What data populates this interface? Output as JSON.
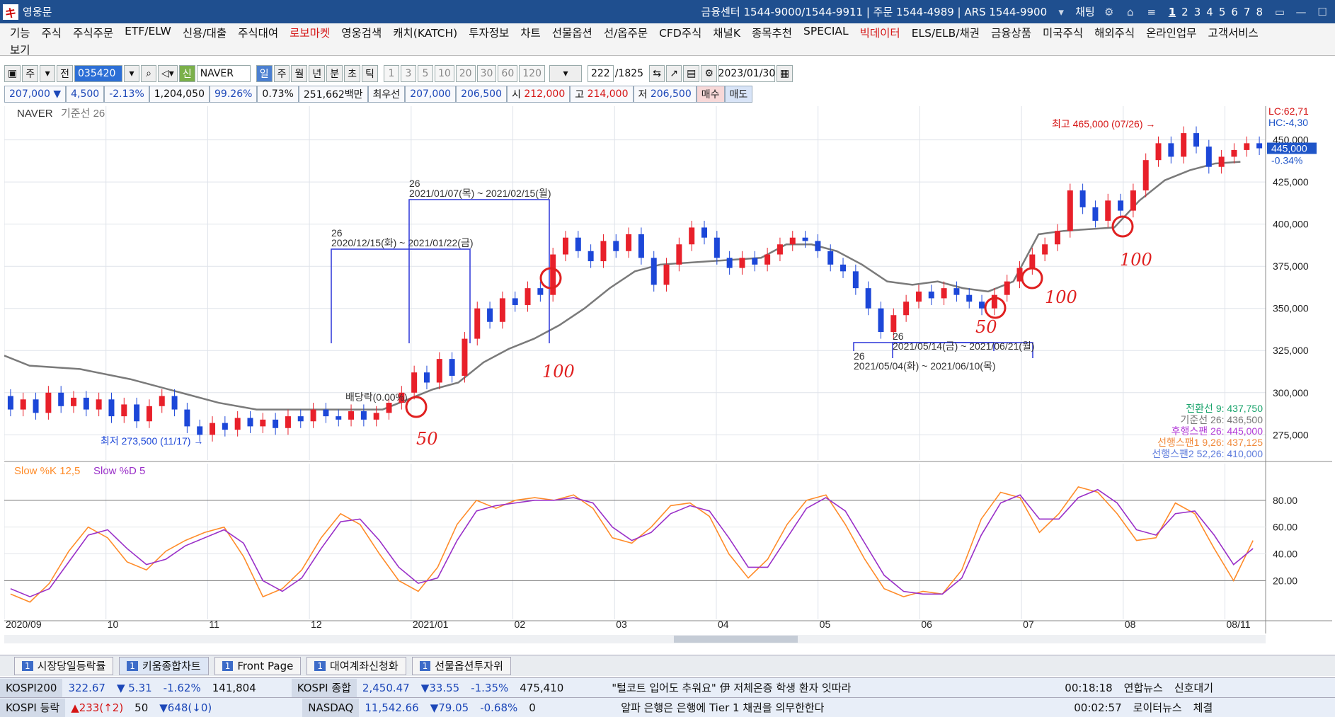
{
  "titlebar": {
    "app_title": "영웅문",
    "info": "금융센터 1544-9000/1544-9911 | 주문 1544-4989 | ARS 1544-9900",
    "chat": "채팅",
    "pages": [
      "1",
      "2",
      "3",
      "4",
      "5",
      "6",
      "7",
      "8"
    ]
  },
  "menu": {
    "items": [
      {
        "label": "기능"
      },
      {
        "label": "주식"
      },
      {
        "label": "주식주문"
      },
      {
        "label": "ETF/ELW"
      },
      {
        "label": "신용/대출"
      },
      {
        "label": "주식대여"
      },
      {
        "label": "로보마켓",
        "color": "red"
      },
      {
        "label": "영웅검색"
      },
      {
        "label": "캐치(KATCH)"
      },
      {
        "label": "투자정보"
      },
      {
        "label": "차트"
      },
      {
        "label": "선물옵션"
      },
      {
        "label": "선/옵주문"
      },
      {
        "label": "CFD주식"
      },
      {
        "label": "채널K"
      },
      {
        "label": "종목추천"
      },
      {
        "label": "SPECIAL"
      },
      {
        "label": "빅데이터",
        "color": "red"
      },
      {
        "label": "ELS/ELB/채권"
      },
      {
        "label": "금융상품"
      },
      {
        "label": "미국주식"
      },
      {
        "label": "해외주식"
      },
      {
        "label": "온라인업무"
      },
      {
        "label": "고객서비스"
      }
    ],
    "row2": "보기"
  },
  "toolbar": {
    "market": "주",
    "prev": "전",
    "code": "035420",
    "new_label": "신",
    "stock_name": "NAVER",
    "periods": [
      "일",
      "주",
      "월",
      "년",
      "분",
      "초",
      "틱"
    ],
    "selected_period": "일",
    "counts": [
      "1",
      "3",
      "5",
      "10",
      "20",
      "30",
      "60",
      "120"
    ],
    "record_count": "222",
    "record_total": "/1825",
    "date": "2023/01/30"
  },
  "quote": {
    "price": "207,000",
    "change": "4,500",
    "change_pct": "-2.13%",
    "volume": "1,204,050",
    "vol_ratio": "99.26%",
    "turnover_pct": "0.73%",
    "amount": "251,662백만",
    "best_label": "최우선",
    "bid1": "207,000",
    "ask1": "206,500",
    "open_label": "시",
    "open": "212,000",
    "high_label": "고",
    "high": "214,000",
    "low_label": "저",
    "low": "206,500",
    "buy_label": "매수",
    "sell_label": "매도"
  },
  "colors": {
    "up": "#e8202a",
    "down": "#1c47d8",
    "kijun": "#7a7a7a",
    "slowk": "#ff8c2a",
    "slowd": "#9a30c8",
    "annotation": "#e02020",
    "boxes": "#2b35d8"
  },
  "chart_data": [
    {
      "type": "line",
      "title": "NAVER",
      "subtitle": "기준선 26",
      "ylim": [
        260000,
        470000
      ],
      "yticks": [
        "275,000",
        "300,000",
        "325,000",
        "350,000",
        "375,000",
        "400,000",
        "425,000",
        "450,000"
      ],
      "xticks": [
        "2020/09",
        "10",
        "11",
        "12",
        "2021/01",
        "02",
        "03",
        "04",
        "05",
        "06",
        "07",
        "08",
        "08/11"
      ],
      "current_price_label": "445,000",
      "current_change_label": "-0.34%",
      "lc_label": "LC:62,71",
      "hc_label": "HC:-4,30",
      "high_label": "최고 465,000 (07/26)",
      "low_label": "최저 273,500 (11/17)",
      "dividend_label": "배당락(0.00%)",
      "kijun_series": [
        {
          "x": 0.0,
          "y": 322000
        },
        {
          "x": 0.02,
          "y": 316000
        },
        {
          "x": 0.06,
          "y": 314000
        },
        {
          "x": 0.1,
          "y": 308000
        },
        {
          "x": 0.14,
          "y": 300000
        },
        {
          "x": 0.17,
          "y": 294000
        },
        {
          "x": 0.2,
          "y": 290000
        },
        {
          "x": 0.26,
          "y": 290000
        },
        {
          "x": 0.3,
          "y": 290000
        },
        {
          "x": 0.32,
          "y": 296000
        },
        {
          "x": 0.34,
          "y": 302000
        },
        {
          "x": 0.36,
          "y": 306000
        },
        {
          "x": 0.38,
          "y": 318000
        },
        {
          "x": 0.4,
          "y": 326000
        },
        {
          "x": 0.42,
          "y": 332000
        },
        {
          "x": 0.44,
          "y": 340000
        },
        {
          "x": 0.46,
          "y": 350000
        },
        {
          "x": 0.48,
          "y": 362000
        },
        {
          "x": 0.5,
          "y": 372000
        },
        {
          "x": 0.52,
          "y": 376000
        },
        {
          "x": 0.56,
          "y": 378000
        },
        {
          "x": 0.6,
          "y": 380000
        },
        {
          "x": 0.62,
          "y": 388000
        },
        {
          "x": 0.64,
          "y": 388000
        },
        {
          "x": 0.66,
          "y": 384000
        },
        {
          "x": 0.68,
          "y": 376000
        },
        {
          "x": 0.7,
          "y": 366000
        },
        {
          "x": 0.72,
          "y": 364000
        },
        {
          "x": 0.74,
          "y": 366000
        },
        {
          "x": 0.76,
          "y": 362000
        },
        {
          "x": 0.78,
          "y": 360000
        },
        {
          "x": 0.8,
          "y": 366000
        },
        {
          "x": 0.82,
          "y": 394000
        },
        {
          "x": 0.84,
          "y": 396000
        },
        {
          "x": 0.88,
          "y": 398000
        },
        {
          "x": 0.9,
          "y": 414000
        },
        {
          "x": 0.92,
          "y": 426000
        },
        {
          "x": 0.94,
          "y": 432000
        },
        {
          "x": 0.96,
          "y": 436000
        },
        {
          "x": 0.98,
          "y": 437000
        }
      ],
      "candles": [
        {
          "x": 0.005,
          "o": 298,
          "c": 290
        },
        {
          "x": 0.015,
          "o": 290,
          "c": 296
        },
        {
          "x": 0.025,
          "o": 296,
          "c": 288
        },
        {
          "x": 0.035,
          "o": 288,
          "c": 300
        },
        {
          "x": 0.045,
          "o": 300,
          "c": 292
        },
        {
          "x": 0.055,
          "o": 292,
          "c": 297
        },
        {
          "x": 0.065,
          "o": 297,
          "c": 290
        },
        {
          "x": 0.075,
          "o": 290,
          "c": 296
        },
        {
          "x": 0.085,
          "o": 296,
          "c": 286
        },
        {
          "x": 0.095,
          "o": 286,
          "c": 293
        },
        {
          "x": 0.105,
          "o": 293,
          "c": 283
        },
        {
          "x": 0.115,
          "o": 283,
          "c": 292
        },
        {
          "x": 0.125,
          "o": 292,
          "c": 298
        },
        {
          "x": 0.135,
          "o": 298,
          "c": 290
        },
        {
          "x": 0.145,
          "o": 290,
          "c": 280
        },
        {
          "x": 0.155,
          "o": 280,
          "c": 275
        },
        {
          "x": 0.165,
          "o": 275,
          "c": 282
        },
        {
          "x": 0.175,
          "o": 282,
          "c": 278
        },
        {
          "x": 0.185,
          "o": 278,
          "c": 285
        },
        {
          "x": 0.195,
          "o": 285,
          "c": 280
        },
        {
          "x": 0.205,
          "o": 280,
          "c": 284
        },
        {
          "x": 0.215,
          "o": 284,
          "c": 279
        },
        {
          "x": 0.225,
          "o": 279,
          "c": 286
        },
        {
          "x": 0.235,
          "o": 286,
          "c": 283
        },
        {
          "x": 0.245,
          "o": 283,
          "c": 290
        },
        {
          "x": 0.255,
          "o": 290,
          "c": 286
        },
        {
          "x": 0.265,
          "o": 286,
          "c": 284
        },
        {
          "x": 0.275,
          "o": 284,
          "c": 289
        },
        {
          "x": 0.285,
          "o": 289,
          "c": 284
        },
        {
          "x": 0.295,
          "o": 284,
          "c": 288
        },
        {
          "x": 0.305,
          "o": 288,
          "c": 294
        },
        {
          "x": 0.315,
          "o": 294,
          "c": 300
        },
        {
          "x": 0.325,
          "o": 300,
          "c": 312
        },
        {
          "x": 0.335,
          "o": 312,
          "c": 306
        },
        {
          "x": 0.345,
          "o": 306,
          "c": 320
        },
        {
          "x": 0.355,
          "o": 320,
          "c": 310
        },
        {
          "x": 0.365,
          "o": 310,
          "c": 332
        },
        {
          "x": 0.375,
          "o": 332,
          "c": 350
        },
        {
          "x": 0.385,
          "o": 350,
          "c": 342
        },
        {
          "x": 0.395,
          "o": 342,
          "c": 356
        },
        {
          "x": 0.405,
          "o": 356,
          "c": 352
        },
        {
          "x": 0.415,
          "o": 352,
          "c": 362
        },
        {
          "x": 0.425,
          "o": 362,
          "c": 358
        },
        {
          "x": 0.435,
          "o": 358,
          "c": 382
        },
        {
          "x": 0.445,
          "o": 382,
          "c": 392
        },
        {
          "x": 0.455,
          "o": 392,
          "c": 384
        },
        {
          "x": 0.465,
          "o": 384,
          "c": 378
        },
        {
          "x": 0.475,
          "o": 378,
          "c": 390
        },
        {
          "x": 0.485,
          "o": 390,
          "c": 384
        },
        {
          "x": 0.495,
          "o": 384,
          "c": 394
        },
        {
          "x": 0.505,
          "o": 394,
          "c": 380
        },
        {
          "x": 0.515,
          "o": 380,
          "c": 364
        },
        {
          "x": 0.525,
          "o": 364,
          "c": 376
        },
        {
          "x": 0.535,
          "o": 376,
          "c": 388
        },
        {
          "x": 0.545,
          "o": 388,
          "c": 398
        },
        {
          "x": 0.555,
          "o": 398,
          "c": 392
        },
        {
          "x": 0.565,
          "o": 392,
          "c": 380
        },
        {
          "x": 0.575,
          "o": 380,
          "c": 374
        },
        {
          "x": 0.585,
          "o": 374,
          "c": 380
        },
        {
          "x": 0.595,
          "o": 380,
          "c": 376
        },
        {
          "x": 0.605,
          "o": 376,
          "c": 382
        },
        {
          "x": 0.615,
          "o": 382,
          "c": 388
        },
        {
          "x": 0.625,
          "o": 388,
          "c": 392
        },
        {
          "x": 0.635,
          "o": 392,
          "c": 390
        },
        {
          "x": 0.645,
          "o": 390,
          "c": 384
        },
        {
          "x": 0.655,
          "o": 384,
          "c": 376
        },
        {
          "x": 0.665,
          "o": 376,
          "c": 372
        },
        {
          "x": 0.675,
          "o": 372,
          "c": 362
        },
        {
          "x": 0.685,
          "o": 362,
          "c": 350
        },
        {
          "x": 0.695,
          "o": 350,
          "c": 336
        },
        {
          "x": 0.705,
          "o": 336,
          "c": 346
        },
        {
          "x": 0.715,
          "o": 346,
          "c": 354
        },
        {
          "x": 0.725,
          "o": 354,
          "c": 360
        },
        {
          "x": 0.735,
          "o": 360,
          "c": 356
        },
        {
          "x": 0.745,
          "o": 356,
          "c": 362
        },
        {
          "x": 0.755,
          "o": 362,
          "c": 358
        },
        {
          "x": 0.765,
          "o": 358,
          "c": 354
        },
        {
          "x": 0.775,
          "o": 354,
          "c": 350
        },
        {
          "x": 0.785,
          "o": 350,
          "c": 358
        },
        {
          "x": 0.795,
          "o": 358,
          "c": 366
        },
        {
          "x": 0.805,
          "o": 366,
          "c": 374
        },
        {
          "x": 0.815,
          "o": 374,
          "c": 382
        },
        {
          "x": 0.825,
          "o": 382,
          "c": 388
        },
        {
          "x": 0.835,
          "o": 388,
          "c": 396
        },
        {
          "x": 0.845,
          "o": 396,
          "c": 420
        },
        {
          "x": 0.855,
          "o": 420,
          "c": 410
        },
        {
          "x": 0.865,
          "o": 410,
          "c": 402
        },
        {
          "x": 0.875,
          "o": 402,
          "c": 414
        },
        {
          "x": 0.885,
          "o": 414,
          "c": 408
        },
        {
          "x": 0.895,
          "o": 408,
          "c": 420
        },
        {
          "x": 0.905,
          "o": 420,
          "c": 438
        },
        {
          "x": 0.915,
          "o": 438,
          "c": 448
        },
        {
          "x": 0.925,
          "o": 448,
          "c": 440
        },
        {
          "x": 0.935,
          "o": 440,
          "c": 454
        },
        {
          "x": 0.945,
          "o": 454,
          "c": 446
        },
        {
          "x": 0.955,
          "o": 446,
          "c": 434
        },
        {
          "x": 0.965,
          "o": 434,
          "c": 440
        },
        {
          "x": 0.975,
          "o": 440,
          "c": 444
        },
        {
          "x": 0.985,
          "o": 444,
          "c": 448
        },
        {
          "x": 0.995,
          "o": 448,
          "c": 445
        }
      ],
      "legend": [
        {
          "label": "전환선 9: 437,750",
          "color": "#18a36b"
        },
        {
          "label": "기준선 26: 436,500",
          "color": "#777777"
        },
        {
          "label": "후행스팬 26: 445,000",
          "color": "#b23ad8"
        },
        {
          "label": "선행스팬1 9,26: 437,125",
          "color": "#f08a3c"
        },
        {
          "label": "선행스팬2 52,26: 410,000",
          "color": "#5d7bdc"
        }
      ],
      "boxes": [
        {
          "count": "26",
          "label": "2020/12/15(화) ~ 2021/01/22(금)"
        },
        {
          "count": "26",
          "label": "2021/01/07(목) ~ 2021/02/15(월)"
        },
        {
          "count": "26",
          "label": "2021/05/04(화) ~ 2021/06/10(목)"
        },
        {
          "count": "26",
          "label": "2021/05/14(금) ~ 2021/06/21(월)"
        }
      ],
      "annotations": [
        {
          "text": "50"
        },
        {
          "text": "100"
        },
        {
          "text": "50"
        },
        {
          "text": "100"
        },
        {
          "text": "100"
        }
      ]
    },
    {
      "type": "line",
      "title": "Slow %K 12,5",
      "subtitle": "Slow %D 5",
      "ylim": [
        0,
        100
      ],
      "yticks": [
        "20.00",
        "40.00",
        "60.00",
        "80.00"
      ],
      "series": [
        {
          "name": "Slow %K 12,5",
          "values": [
            10,
            4,
            18,
            42,
            60,
            52,
            34,
            28,
            42,
            50,
            56,
            60,
            38,
            8,
            14,
            28,
            52,
            70,
            62,
            40,
            20,
            12,
            30,
            62,
            80,
            74,
            80,
            82,
            80,
            84,
            74,
            52,
            48,
            60,
            76,
            78,
            68,
            40,
            22,
            36,
            62,
            80,
            84,
            62,
            36,
            14,
            8,
            12,
            10,
            28,
            66,
            86,
            82,
            56,
            70,
            90,
            86,
            70,
            50,
            52,
            78,
            70,
            44,
            20,
            50
          ]
        },
        {
          "name": "Slow %D 5",
          "values": [
            14,
            8,
            14,
            34,
            54,
            58,
            44,
            32,
            36,
            46,
            52,
            58,
            48,
            20,
            12,
            22,
            44,
            64,
            66,
            50,
            30,
            18,
            22,
            50,
            72,
            76,
            78,
            80,
            80,
            82,
            78,
            60,
            50,
            56,
            70,
            76,
            72,
            52,
            30,
            30,
            52,
            74,
            82,
            72,
            48,
            24,
            12,
            10,
            10,
            22,
            54,
            78,
            84,
            66,
            66,
            82,
            88,
            78,
            58,
            54,
            70,
            72,
            54,
            32,
            44
          ]
        }
      ]
    }
  ],
  "tabs": [
    {
      "num": "1",
      "label": "시장당일등락률"
    },
    {
      "num": "1",
      "label": "키움종합차트",
      "selected": true
    },
    {
      "num": "1",
      "label": "Front Page"
    },
    {
      "num": "1",
      "label": "대여계좌신청화"
    },
    {
      "num": "1",
      "label": "선물옵션투자위"
    }
  ],
  "ticker_rows": [
    {
      "name": "KOSPI200",
      "value": "322.67",
      "change": "▼ 5.31",
      "pct": "-1.62%",
      "volume": "141,804",
      "name2": "KOSPI 종합",
      "value2": "2,450.47",
      "change2": "▼33.55",
      "pct2": "-1.35%",
      "volume2": "475,410",
      "news": "\"털코트 입어도 추워요\" 伊 저체온증 학생 환자 잇따라",
      "time": "00:18:18",
      "source": "연합뉴스",
      "right": "신호대기"
    },
    {
      "name": "KOSPI 등락",
      "value": "▲233(↑2)",
      "change": "50",
      "pct": "▼648(↓0)",
      "volume": "",
      "name2": "NASDAQ",
      "value2": "11,542.66",
      "change2": "▼79.05",
      "pct2": "-0.68%",
      "volume2": "0",
      "news": "알파 은행은 은행에 Tier 1 채권을 의무한한다",
      "time": "00:02:57",
      "source": "로이터뉴스",
      "right": "체결"
    }
  ]
}
